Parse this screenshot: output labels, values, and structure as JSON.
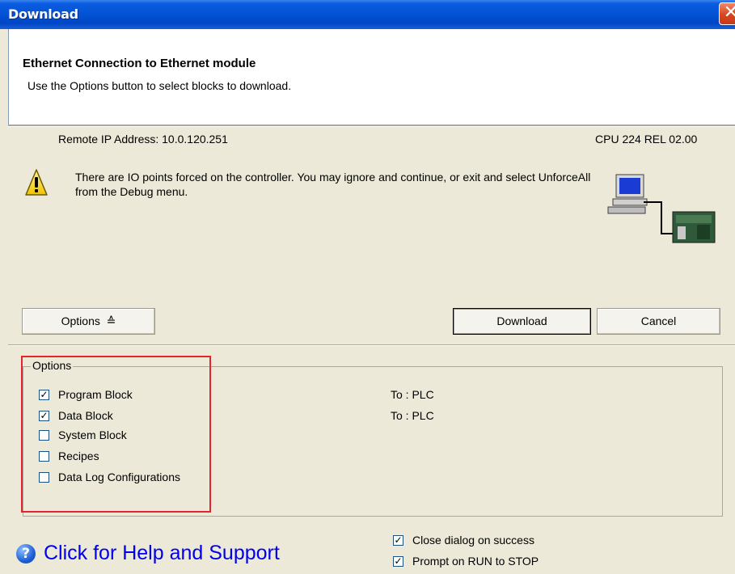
{
  "window": {
    "title": "Download",
    "close_glyph": "✕"
  },
  "header": {
    "title": "Ethernet Connection to Ethernet module",
    "subtitle": "Use the Options button to select blocks to download."
  },
  "connection": {
    "remote_ip": "Remote IP Address: 10.0.120.251",
    "cpu": "CPU 224 REL 02.00"
  },
  "warning": {
    "icon": "warning-icon",
    "text": "There are IO points forced on the controller. You may ignore and continue, or exit and select UnforceAll from the Debug menu."
  },
  "buttons": {
    "options": "Options",
    "options_arrow": "≙",
    "download": "Download",
    "cancel": "Cancel"
  },
  "options": {
    "legend": "Options",
    "items": [
      {
        "label": "Program Block",
        "checked": true,
        "target": "To : PLC"
      },
      {
        "label": "Data Block",
        "checked": true,
        "target": "To : PLC"
      },
      {
        "label": "System Block",
        "checked": false,
        "target": ""
      },
      {
        "label": "Recipes",
        "checked": false,
        "target": ""
      },
      {
        "label": "Data Log Configurations",
        "checked": false,
        "target": ""
      }
    ]
  },
  "footer": {
    "help_text": "Click for Help and Support",
    "close_on_success": {
      "label": "Close dialog on success",
      "checked": true
    },
    "prompt_run_stop": {
      "label": "Prompt on RUN to STOP",
      "checked": true
    }
  },
  "colors": {
    "titlebar": "#0454d6",
    "highlight_box": "#e5242b",
    "help_link": "#0000ee"
  }
}
